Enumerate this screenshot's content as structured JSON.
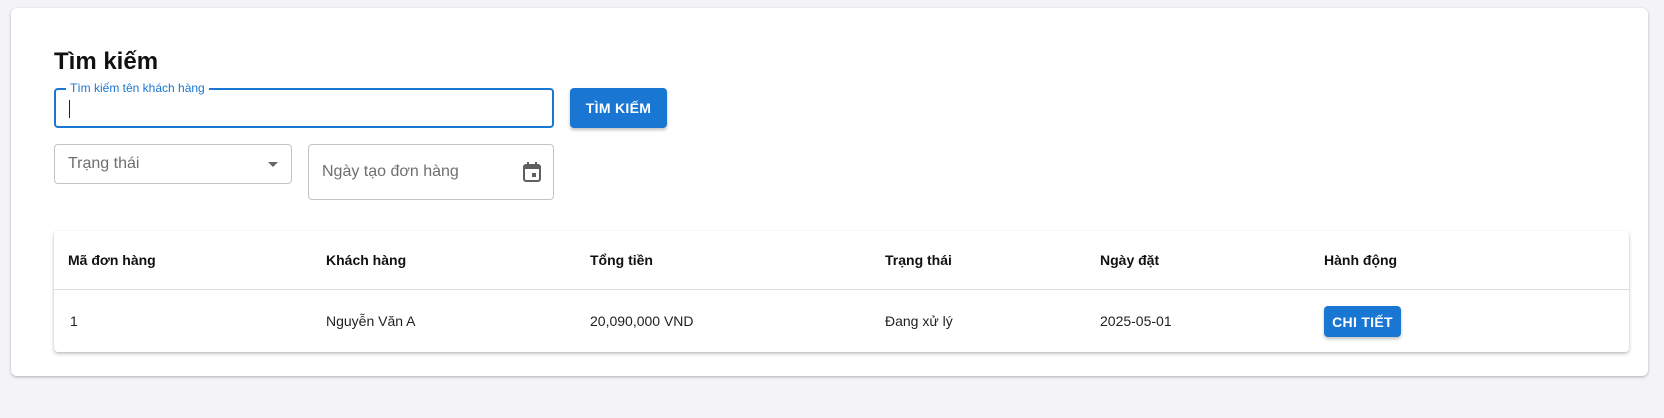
{
  "search_panel": {
    "title": "Tìm kiếm",
    "search_label": "Tìm kiếm tên khách hàng",
    "search_value": "",
    "search_button": "TÌM KIẾM",
    "status_placeholder": "Trạng thái",
    "date_placeholder": "Ngày tạo đơn hàng"
  },
  "table": {
    "columns": [
      "Mã đơn hàng",
      "Khách hàng",
      "Tổng tiền",
      "Trạng thái",
      "Ngày đặt",
      "Hành động"
    ],
    "rows": [
      {
        "order_id": "1",
        "customer": "Nguyễn Văn A",
        "total": "20,090,000 VND",
        "status": "Đang xử lý",
        "date": "2025-05-01",
        "action_label": "CHI TIẾT"
      }
    ]
  },
  "colors": {
    "primary": "#1976d2",
    "page_background": "#f4f4f8"
  },
  "icons": {
    "dropdown": "chevron-down-icon",
    "date": "calendar-icon"
  }
}
